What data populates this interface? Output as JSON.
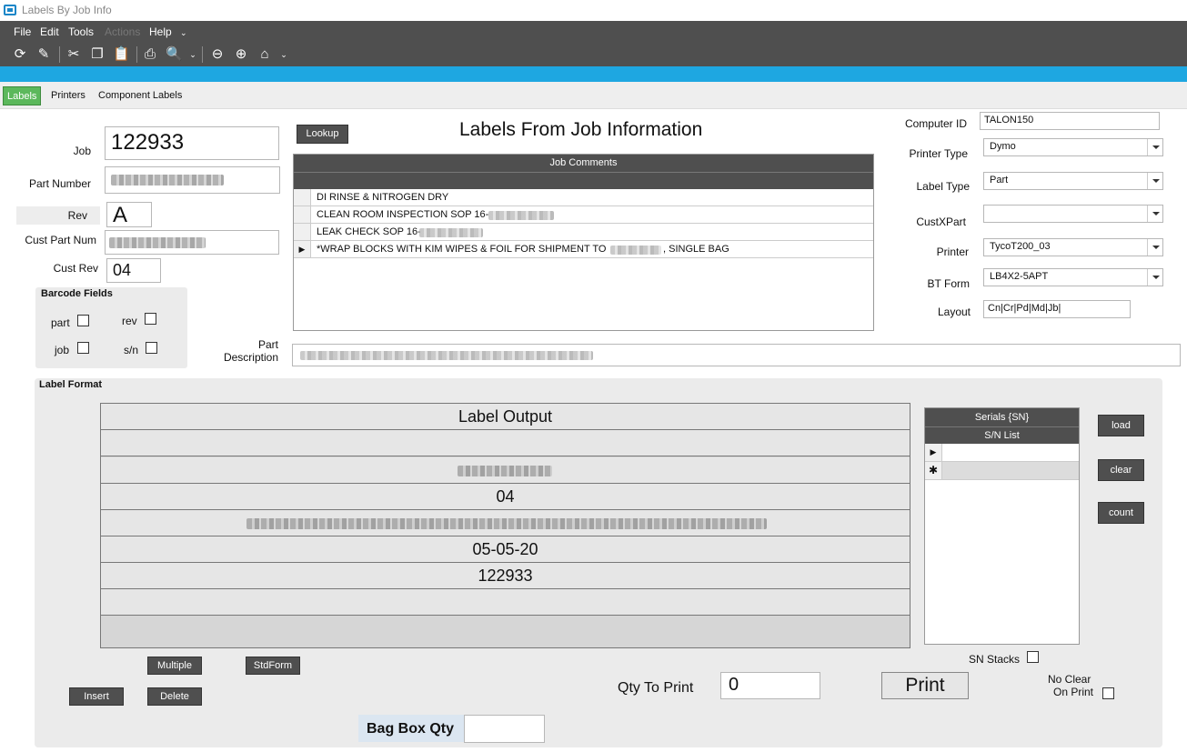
{
  "window": {
    "title": "Labels By Job Info"
  },
  "menu": [
    "File",
    "Edit",
    "Tools",
    "Actions",
    "Help"
  ],
  "tabs": [
    "Labels",
    "Printers",
    "Component Labels"
  ],
  "form": {
    "title": "Labels From Job Information",
    "job_label": "Job",
    "job_value": "122933",
    "part_number_label": "Part Number",
    "rev_label": "Rev",
    "rev_value": "A",
    "cust_part_num_label": "Cust Part Num",
    "cust_rev_label": "Cust Rev",
    "cust_rev_value": "04",
    "lookup_button": "Lookup",
    "barcode_fields": {
      "title": "Barcode Fields",
      "part": "part",
      "rev": "rev",
      "job": "job",
      "sn": "s/n"
    },
    "part_description_label": "Part\nDescription"
  },
  "comments": {
    "header": "Job Comments",
    "rows": [
      "DI RINSE & NITROGEN DRY",
      "CLEAN ROOM INSPECTION SOP 16-",
      "LEAK CHECK SOP 16-",
      "*WRAP BLOCKS WITH KIM WIPES & FOIL FOR SHIPMENT TO"
    ],
    "row4_suffix": ", SINGLE BAG"
  },
  "printer": {
    "computer_id_label": "Computer ID",
    "computer_id": "TALON150",
    "printer_type_label": "Printer Type",
    "printer_type": "Dymo",
    "label_type_label": "Label Type",
    "label_type": "Part",
    "custxpart_label": "CustXPart",
    "custxpart": "",
    "printer_label": "Printer",
    "printer": "TycoT200_03",
    "bt_form_label": "BT Form",
    "bt_form": "LB4X2-5APT",
    "layout_label": "Layout",
    "layout": "Cn|Cr|Pd|Md|Jb|"
  },
  "label_format": {
    "title": "Label Format",
    "output_header": "Label Output",
    "rows": [
      "",
      "",
      "04",
      "",
      "05-05-20",
      "122933",
      ""
    ]
  },
  "serials": {
    "header": "Serials {SN}",
    "list_header": "S/N List",
    "load": "load",
    "clear": "clear",
    "count": "count",
    "sn_stacks": "SN Stacks"
  },
  "buttons": {
    "multiple": "Multiple",
    "stdform": "StdForm",
    "insert": "Insert",
    "delete": "Delete",
    "print": "Print"
  },
  "qty": {
    "label": "Qty To Print",
    "value": "0"
  },
  "no_clear": {
    "label1": "No Clear",
    "label2": "On Print"
  },
  "bag_box": {
    "label": "Bag Box Qty",
    "value": ""
  }
}
